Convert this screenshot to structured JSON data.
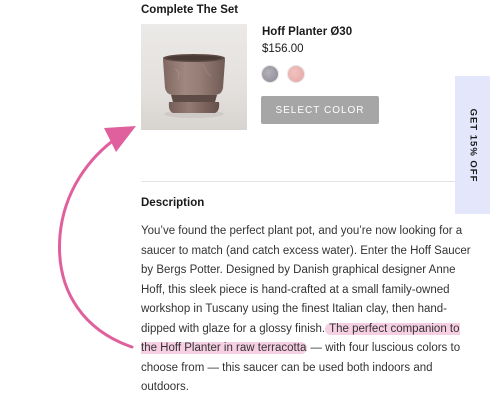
{
  "complete_the_set": {
    "title": "Complete The Set",
    "product": {
      "name": "Hoff Planter Ø30",
      "price": "$156.00",
      "swatches": [
        {
          "name": "grey",
          "color": "#9c98a2"
        },
        {
          "name": "pink",
          "color": "#eab1ae"
        }
      ],
      "select_label": "SELECT COLOR"
    }
  },
  "description": {
    "heading": "Description",
    "text_before": "You’ve found the perfect plant pot, and you’re now looking for a saucer to match (and catch excess water). Enter the Hoff Saucer by Bergs Potter. Designed by Danish graphical designer Anne Hoff, this sleek piece is hand-crafted at a small family-owned workshop in Tuscany using the finest Italian clay, then hand-dipped with glaze for a glossy finish.",
    "text_highlight": " The perfect companion to the Hoff Planter in raw terracotta",
    "text_after": " — with four luscious colors to choose from — this saucer can be used both indoors and outdoors."
  },
  "promo_tab": {
    "label": "GET 15% OFF"
  },
  "colors": {
    "highlight": "#f6cfe2",
    "arrow": "#e0609e",
    "button": "#a6a6a6",
    "promo_bg": "#e4e6fb"
  }
}
